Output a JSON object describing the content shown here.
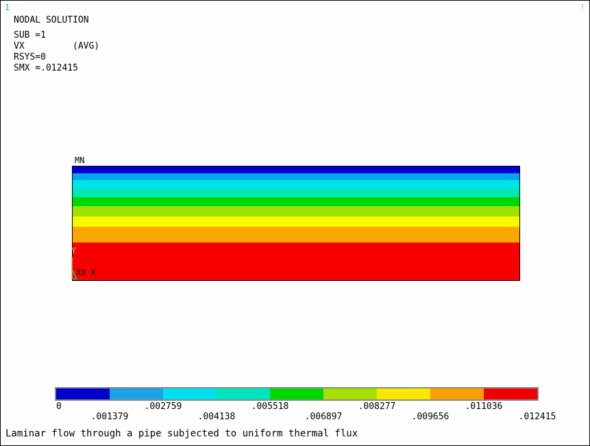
{
  "window_number": "1",
  "corner_mark": "!",
  "info": {
    "title": "NODAL SOLUTION",
    "rows": [
      {
        "label": "SUB =1",
        "value": ""
      },
      {
        "label": "VX",
        "value": "(AVG)"
      },
      {
        "label": "RSYS=0",
        "value": ""
      },
      {
        "label": "SMX =.012415",
        "value": ""
      }
    ]
  },
  "model": {
    "min_label": "MN",
    "axis_y": "Y",
    "axis_x": "XX X",
    "bands": [
      {
        "color": "#0000cc",
        "value_level": 0
      },
      {
        "color": "#00a8f0",
        "value_level": 1
      },
      {
        "color": "#00e4e4",
        "value_level": 2
      },
      {
        "color": "#00e8b0",
        "value_level": 3
      },
      {
        "color": "#00d800",
        "value_level": 4
      },
      {
        "color": "#a0e000",
        "value_level": 5
      },
      {
        "color": "#f8f800",
        "value_level": 6
      },
      {
        "color": "#f8a800",
        "value_level": 7
      },
      {
        "color": "#f80000",
        "value_level": 8
      }
    ],
    "band_fractions": [
      0.06,
      0.06,
      0.08,
      0.07,
      0.08,
      0.09,
      0.09,
      0.14,
      0.33
    ]
  },
  "legend": {
    "colors": [
      "#0000cc",
      "#1ca0e8",
      "#00e0f0",
      "#00e4c0",
      "#00d800",
      "#a8e000",
      "#f8e800",
      "#f8a000",
      "#f00000"
    ],
    "top_labels": [
      "0",
      ".002759",
      ".005518",
      ".008277",
      ".011036"
    ],
    "bottom_labels": [
      ".001379",
      ".004138",
      ".006897",
      ".009656",
      ".012415"
    ]
  },
  "caption": "Laminar flow through a pipe subjected to uniform thermal flux"
}
